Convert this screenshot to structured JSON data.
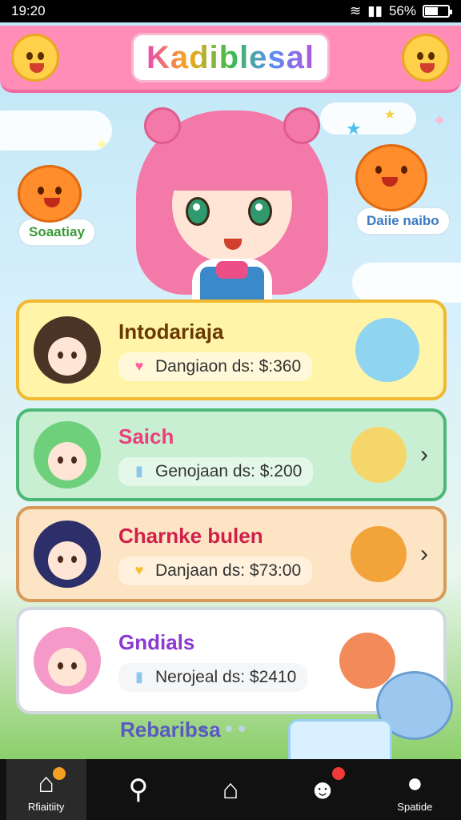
{
  "status_bar": {
    "time": "19:20",
    "battery": "56%",
    "battery_level": 0.56
  },
  "header": {
    "title": "Kadiblesal",
    "left_mascot_icon": "yellow-smiley-mascot",
    "right_mascot_icon": "yellow-smiley-mascot"
  },
  "hero": {
    "left_label": "Soaatiay",
    "right_label": "Daiie naibo",
    "character_icon": "pink-haired-anime-girl"
  },
  "cards": [
    {
      "title": "Intodariaja",
      "subtitle": "Dangiaon ds: $:360",
      "pill_icon": "heart-icon",
      "colors": {
        "bg": "#fff4a8",
        "border": "#f1b92f",
        "title": "#6a3a00",
        "pill": "#fff9d9",
        "icon": "#ff5fa0"
      }
    },
    {
      "title": "Saich",
      "subtitle": "Genojaan ds: $:200",
      "pill_icon": "badge-icon",
      "colors": {
        "bg": "#c9efd3",
        "border": "#4cb878",
        "title": "#e8407a",
        "pill": "#e3f8e9",
        "icon": "#8bc6ef"
      }
    },
    {
      "title": "Charnke bulen",
      "subtitle": "Danjaan ds: $73:00",
      "pill_icon": "heart-icon",
      "colors": {
        "bg": "#fde4c4",
        "border": "#d89a58",
        "title": "#d0204a",
        "pill": "#fff1dc",
        "icon": "#f4c02c"
      }
    },
    {
      "title": "Gndials",
      "subtitle": "Nerojeal ds: $2410",
      "pill_icon": "badge-icon",
      "colors": {
        "bg": "#ffffff",
        "border": "#d0d8e0",
        "title": "#8a3ad0",
        "pill": "#f4f6f8",
        "icon": "#8bc6ef"
      }
    }
  ],
  "peek_card": {
    "title": "Rebaribsa"
  },
  "bottom_nav": [
    {
      "label": "Rfiaitiity",
      "icon": "home-icon",
      "active": true
    },
    {
      "label": "",
      "icon": "search-icon",
      "active": false
    },
    {
      "label": "",
      "icon": "house-outline-icon",
      "active": false
    },
    {
      "label": "",
      "icon": "chat-icon",
      "active": false
    },
    {
      "label": "Spatide",
      "icon": "profile-icon",
      "active": false
    }
  ]
}
